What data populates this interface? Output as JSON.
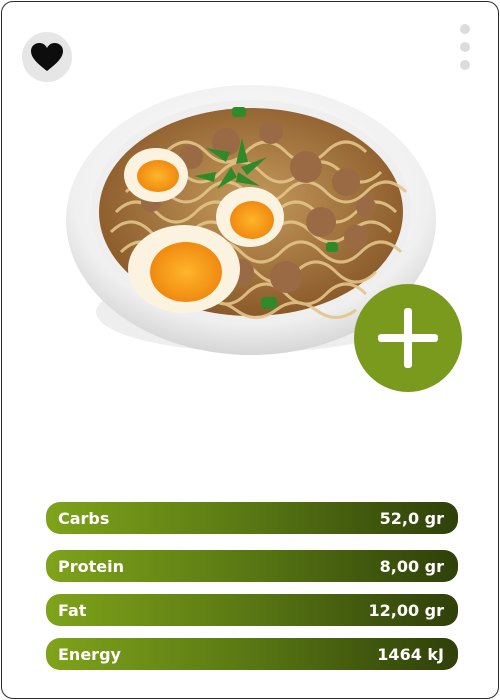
{
  "header": {
    "favorite_icon": "heart-icon",
    "more_icon": "more-vertical-icon"
  },
  "food": {
    "image_alt": "ramen",
    "add_icon": "plus-icon"
  },
  "nutrients": [
    {
      "label": "Carbs",
      "value": "52,0 gr"
    },
    {
      "label": "Protein",
      "value": "8,00 gr"
    },
    {
      "label": "Fat",
      "value": "12,00 gr"
    },
    {
      "label": "Energy",
      "value": "1464 kJ"
    }
  ],
  "colors": {
    "accent": "#7a9a1e",
    "bar_start": "#7fa31a",
    "bar_end": "#2f4009"
  }
}
